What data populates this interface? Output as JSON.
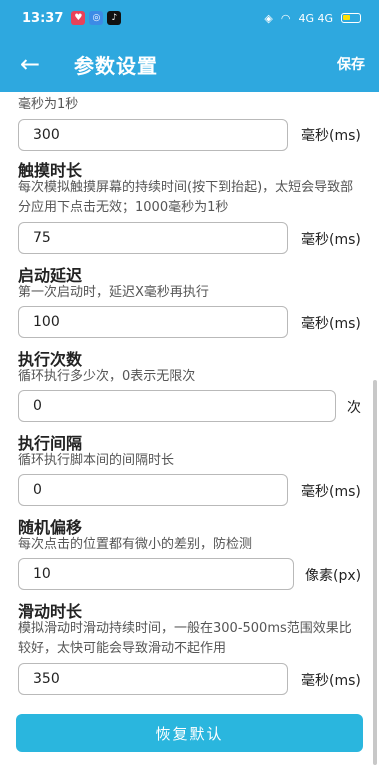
{
  "status": {
    "time": "13:37",
    "network": "4G 4G"
  },
  "header": {
    "back_icon": "arrow-left-icon",
    "title": "参数设置",
    "save_label": "保存"
  },
  "colors": {
    "primary": "#2ea8df",
    "button": "#2ab6de"
  },
  "top_desc": "毫秒为1秒",
  "settings": [
    {
      "label": "",
      "desc": "",
      "value": "300",
      "unit": "毫秒(ms)"
    },
    {
      "label": "触摸时长",
      "desc": "每次模拟触摸屏幕的持续时间(按下到抬起)，太短会导致部分应用下点击无效；1000毫秒为1秒",
      "value": "75",
      "unit": "毫秒(ms)"
    },
    {
      "label": "启动延迟",
      "desc": "第一次启动时，延迟X毫秒再执行",
      "value": "100",
      "unit": "毫秒(ms)"
    },
    {
      "label": "执行次数",
      "desc": "循环执行多少次，0表示无限次",
      "value": "0",
      "unit": "次"
    },
    {
      "label": "执行间隔",
      "desc": "循环执行脚本间的间隔时长",
      "value": "0",
      "unit": "毫秒(ms)"
    },
    {
      "label": "随机偏移",
      "desc": "每次点击的位置都有微小的差别，防检测",
      "value": "10",
      "unit": "像素(px)"
    },
    {
      "label": "滑动时长",
      "desc": "模拟滑动时滑动持续时间，一般在300-500ms范围效果比较好，太快可能会导致滑动不起作用",
      "value": "350",
      "unit": "毫秒(ms)"
    }
  ],
  "reset_label": "恢复默认"
}
